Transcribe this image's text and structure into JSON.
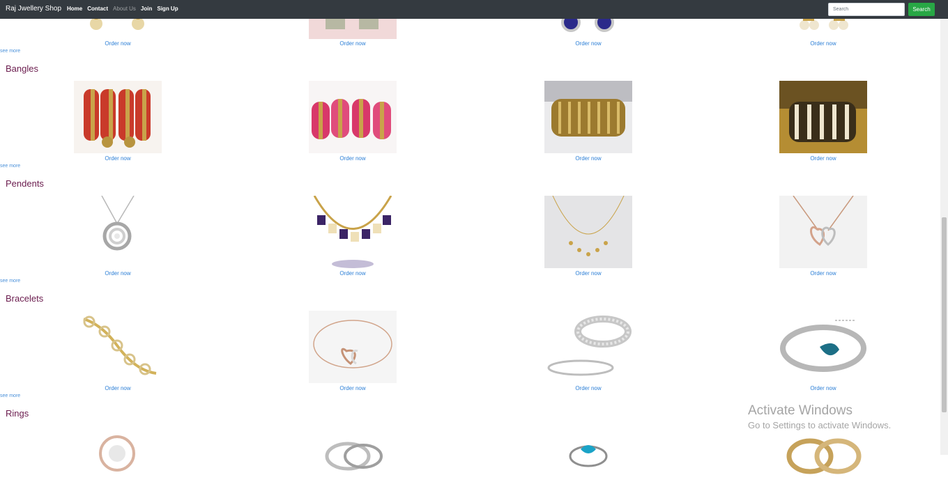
{
  "navbar": {
    "brand": "Raj Jwellery Shop",
    "links": [
      "Home",
      "Contact",
      "About Us",
      "Join",
      "Sign Up"
    ],
    "search_placeholder": "Search",
    "search_button": "Search"
  },
  "product": {
    "order_label": "Order now",
    "see_more_label": "see more"
  },
  "sections": [
    {
      "title": "Bangles"
    },
    {
      "title": "Pendents"
    },
    {
      "title": "Bracelets"
    },
    {
      "title": "Rings"
    }
  ],
  "watermark": {
    "title": "Activate Windows",
    "subtitle": "Go to Settings to activate Windows."
  },
  "colors": {
    "navbar_bg": "#343a40",
    "search_button": "#28a745",
    "link_blue": "#2c7fd6",
    "section_title": "#6a1b4d"
  }
}
